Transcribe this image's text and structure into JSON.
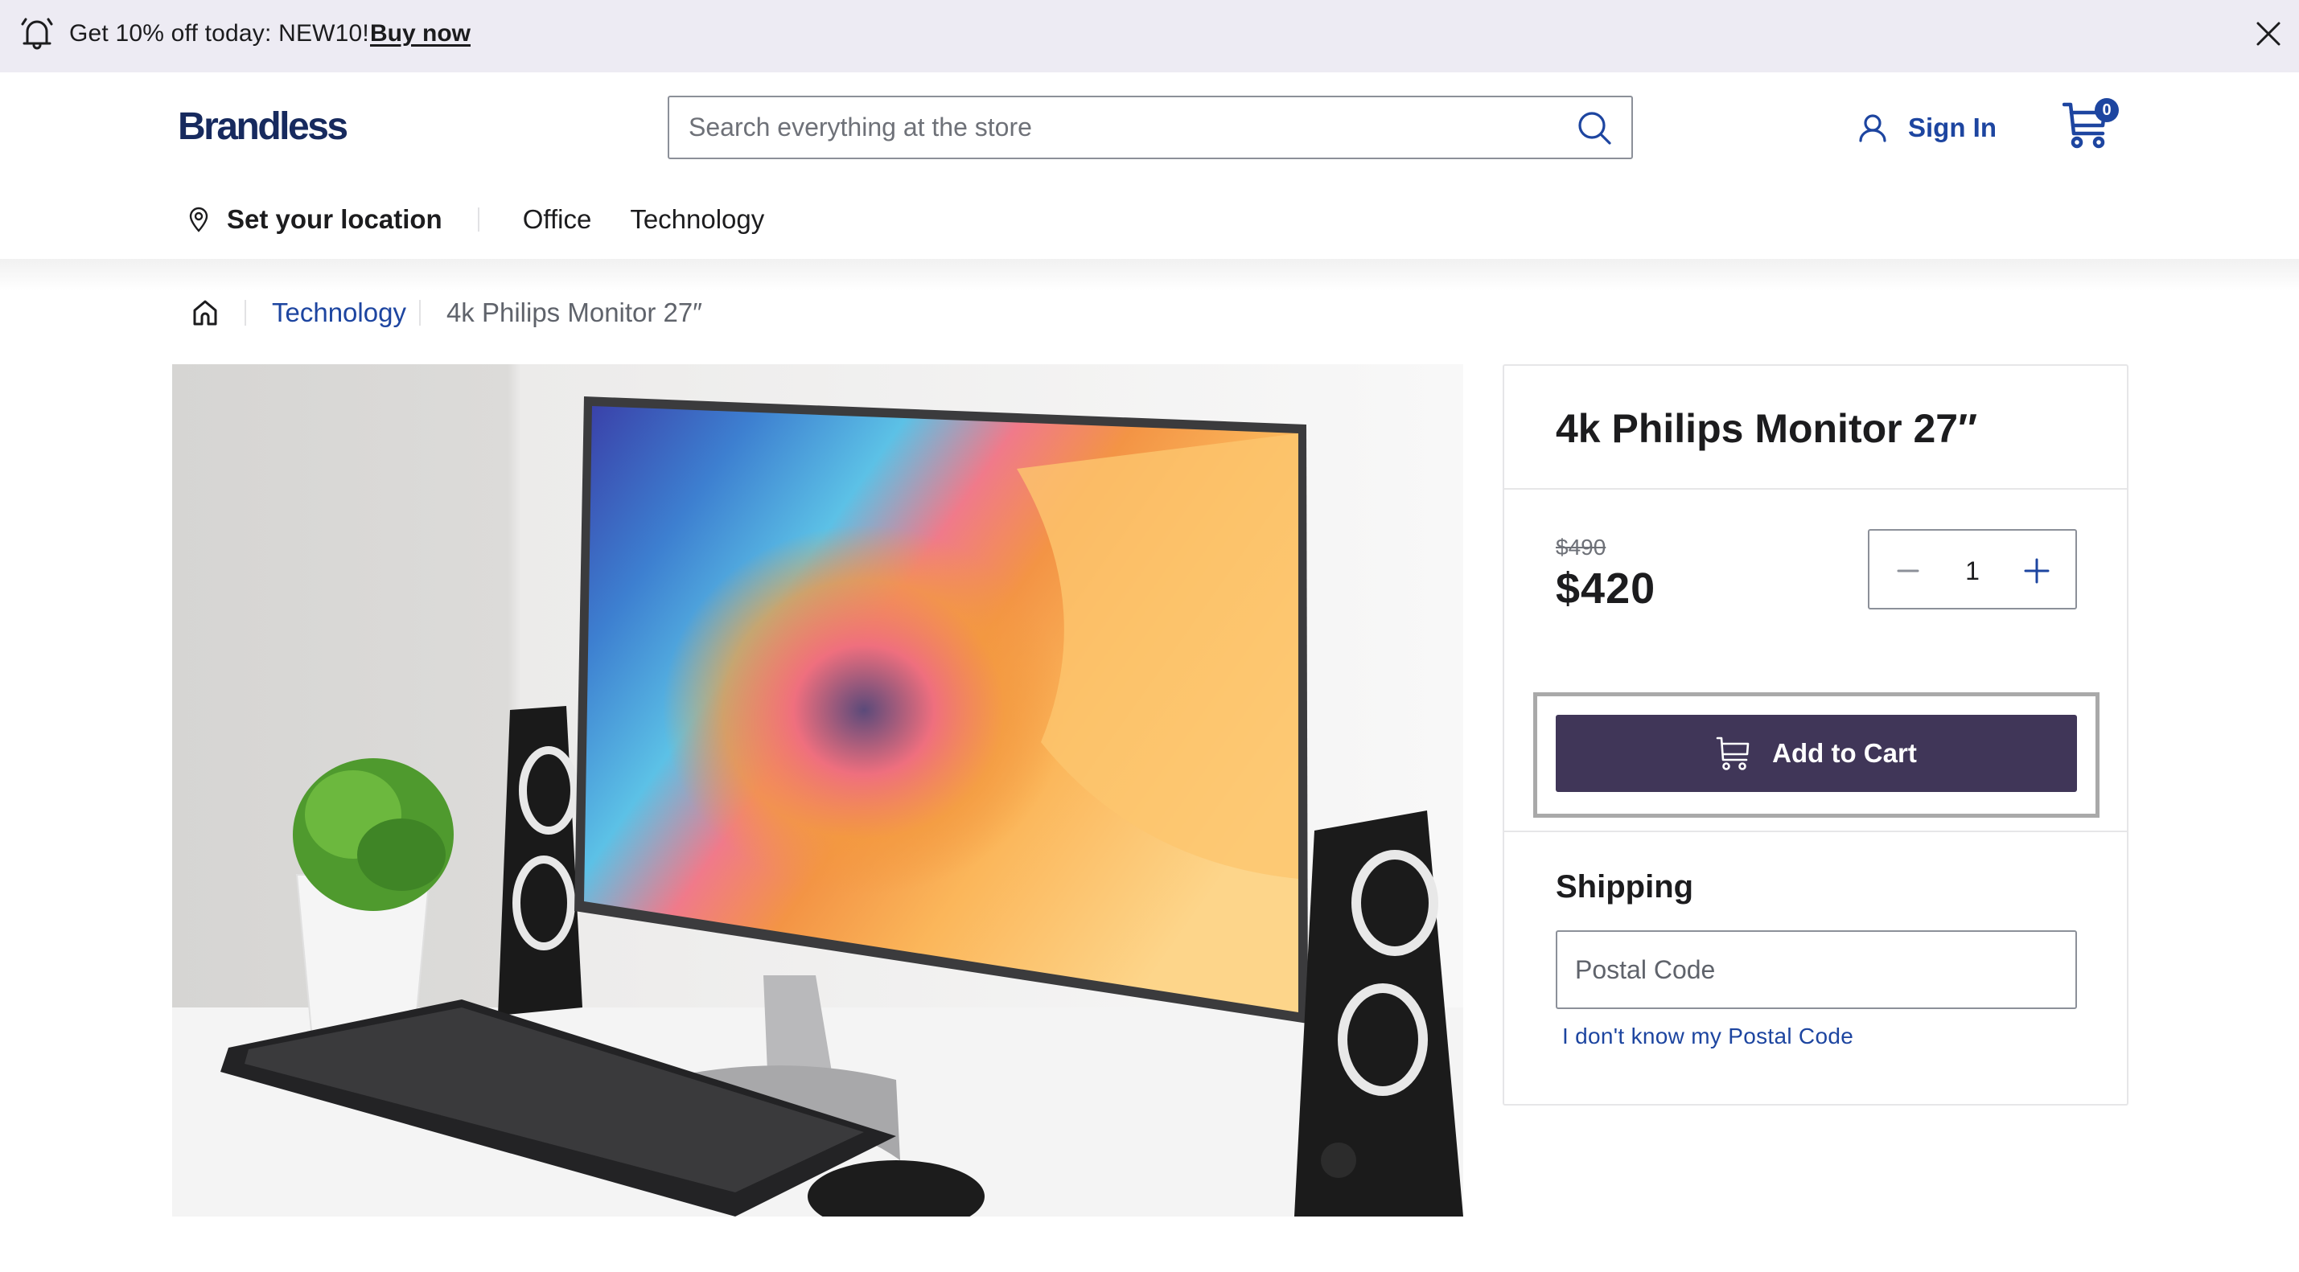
{
  "promo": {
    "icon": "bell-icon",
    "message": "Get 10% off today: NEW10!",
    "link_label": "Buy now",
    "close_icon": "close-icon"
  },
  "header": {
    "logo": "Brandless",
    "search": {
      "placeholder": "Search everything at the store",
      "value": "",
      "icon": "search-icon"
    },
    "sign_in_label": "Sign In",
    "cart_count": "0"
  },
  "nav": {
    "location_label": "Set your location",
    "links": [
      "Office",
      "Technology"
    ]
  },
  "breadcrumb": {
    "home_icon": "home-icon",
    "category": "Technology",
    "current": "4k Philips Monitor 27″"
  },
  "product": {
    "image_alt": "Desk setup with monitor, speakers, keyboard and plant",
    "title": "4k Philips Monitor 27″",
    "original_price": "$490",
    "price": "$420",
    "quantity": "1",
    "add_to_cart_label": "Add to Cart"
  },
  "shipping": {
    "title": "Shipping",
    "postal_placeholder": "Postal Code",
    "postal_value": "",
    "unknown_link": "I don't know my Postal Code"
  },
  "colors": {
    "brand": "#172a5e",
    "accent": "#1d45a0",
    "button": "#403658",
    "promo_bg": "#edebf3"
  }
}
